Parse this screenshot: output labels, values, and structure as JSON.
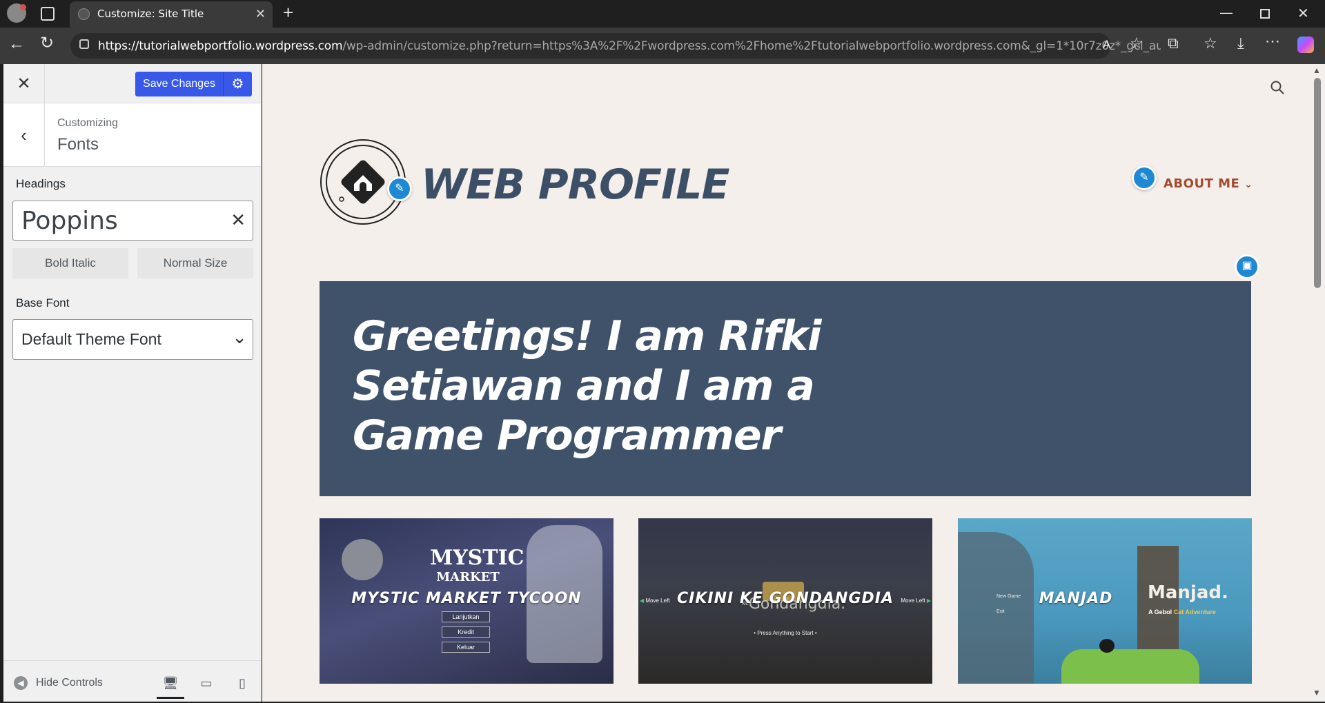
{
  "browser": {
    "tab_title": "Customize: Site Title",
    "url_host": "https://tutorialwebportfolio.wordpress.com",
    "url_path": "/wp-admin/customize.php?return=https%3A%2F%2Fwordpress.com%2Fhome%2Ftutorialwebportfolio.wordpress.com&_gl=1*10r7z0z*_gcl_au..."
  },
  "sidebar": {
    "save_label": "Save Changes",
    "customizing_label": "Customizing",
    "section_title": "Fonts",
    "headings_label": "Headings",
    "headings_value": "Poppins",
    "bold_italic_label": "Bold Italic",
    "normal_size_label": "Normal Size",
    "base_font_label": "Base Font",
    "base_font_value": "Default Theme Font",
    "hide_controls_label": "Hide Controls"
  },
  "preview": {
    "site_title": "WEB PROFILE",
    "nav_about": "ABOUT ME",
    "hero_heading": "Greetings! I am Rifki Setiawan and I am a Game Programmer",
    "games": [
      {
        "title": "MYSTIC MARKET TYCOON",
        "logo_line1": "MYSTIC",
        "logo_line2": "MARKET",
        "menu": [
          "Lanjutkan",
          "Kredit",
          "Keluar"
        ]
      },
      {
        "title": "CIKINI KE GONDANGDIA",
        "logo": "Gondangdia.",
        "logo_pre": "ke",
        "prompt": "• Press Anything to Start •",
        "left_hint": "Move Left",
        "right_hint": "Move Left"
      },
      {
        "title": "MANJAD",
        "logo": "Manjad.",
        "tagline_a": "A Gebol",
        "tagline_b": "Cat Adventure",
        "menu": [
          "New Game",
          "Exit"
        ]
      }
    ]
  },
  "colors": {
    "save_blue": "#3858e9",
    "title_color": "#3d4f66",
    "hero_bg": "#3f5269",
    "nav_color": "#a34a2e",
    "edit_blue": "#1e88d3",
    "preview_bg": "#f4efea"
  }
}
